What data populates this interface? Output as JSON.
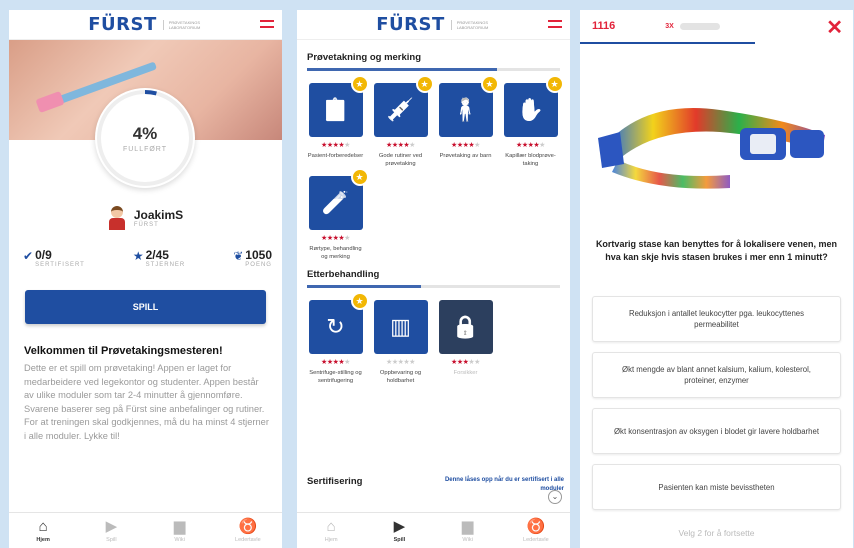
{
  "brand": {
    "logo": "FÜRST",
    "logo_sub": "PRØVETAKINGS LABORATORIUM"
  },
  "screen1": {
    "progress_pct": "4%",
    "progress_label": "FULLFØRT",
    "progress_value": 0.04,
    "user_name": "JoakimS",
    "user_org": "FÜRST",
    "stats": [
      {
        "icon": "check-icon",
        "value": "0/9",
        "label": "SERTIFISERT"
      },
      {
        "icon": "star-icon",
        "value": "2/45",
        "label": "STJERNER"
      },
      {
        "icon": "medal-icon",
        "value": "1050",
        "label": "POENG"
      }
    ],
    "play_button": "SPILL",
    "welcome_title": "Velkommen til Prøvetakingsmesteren!",
    "welcome_body": "Dette er et spill om prøvetaking! Appen er laget for medarbeidere ved legekontor og studenter. Appen består av ulike moduler som tar 2-4 minutter å gjennomføre. Svarene baserer seg på Fürst sine anbefalinger og rutiner. For at treningen skal godkjennes, må du ha minst 4 stjerner i alle moduler.  Lykke til!"
  },
  "tabs": [
    {
      "icon": "home-icon",
      "label": "Hjem"
    },
    {
      "icon": "play-icon",
      "label": "Spill"
    },
    {
      "icon": "book-icon",
      "label": "Wiki"
    },
    {
      "icon": "trophy-icon",
      "label": "Ledertavle"
    }
  ],
  "screen2": {
    "section1": {
      "title": "Prøvetakning og merking",
      "progress": 0.75
    },
    "modules1": [
      {
        "icon": "clipboard-icon",
        "label": "Pasient-forberedelser",
        "stars": 4
      },
      {
        "icon": "syringe-icon",
        "label": "Gode rutiner ved prøvetaking",
        "stars": 4
      },
      {
        "icon": "child-icon",
        "label": "Prøvetaking av barn",
        "stars": 4
      },
      {
        "icon": "hand-icon",
        "label": "Kapillær blodprøve-taking",
        "stars": 4
      },
      {
        "icon": "tube-icon",
        "label": "Rørtype, behandling og merking",
        "stars": 4
      }
    ],
    "section2": {
      "title": "Etterbehandling",
      "progress": 0.45
    },
    "modules2": [
      {
        "icon": "centrifuge-icon",
        "label": "Sentrifuge-stilling og sentrifugering",
        "stars": 4
      },
      {
        "icon": "fridge-icon",
        "label": "Oppbevaring og holdbarhet",
        "stars": 0
      },
      {
        "icon": "lock-icon",
        "label": "Forsikker",
        "stars": 3,
        "locked": true
      }
    ],
    "cert_title": "Sertifisering",
    "cert_note": "Denne låses opp når du er sertifisert i alle moduler"
  },
  "screen3": {
    "score": "1116",
    "multiplier": "3X",
    "question": "Kortvarig stase kan benyttes for å lokalisere venen, men hva kan skje hvis stasen brukes i mer enn 1 minutt?",
    "answers": [
      "Reduksjon i antallet leukocytter pga. leukocyttenes permeabilitet",
      "Økt mengde av blant annet kalsium, kalium, kolesterol, proteiner, enzymer",
      "Økt konsentrasjon av oksygen i blodet gir lavere holdbarhet",
      "Pasienten kan miste bevisstheten"
    ],
    "hint": "Velg 2 for å fortsette"
  }
}
